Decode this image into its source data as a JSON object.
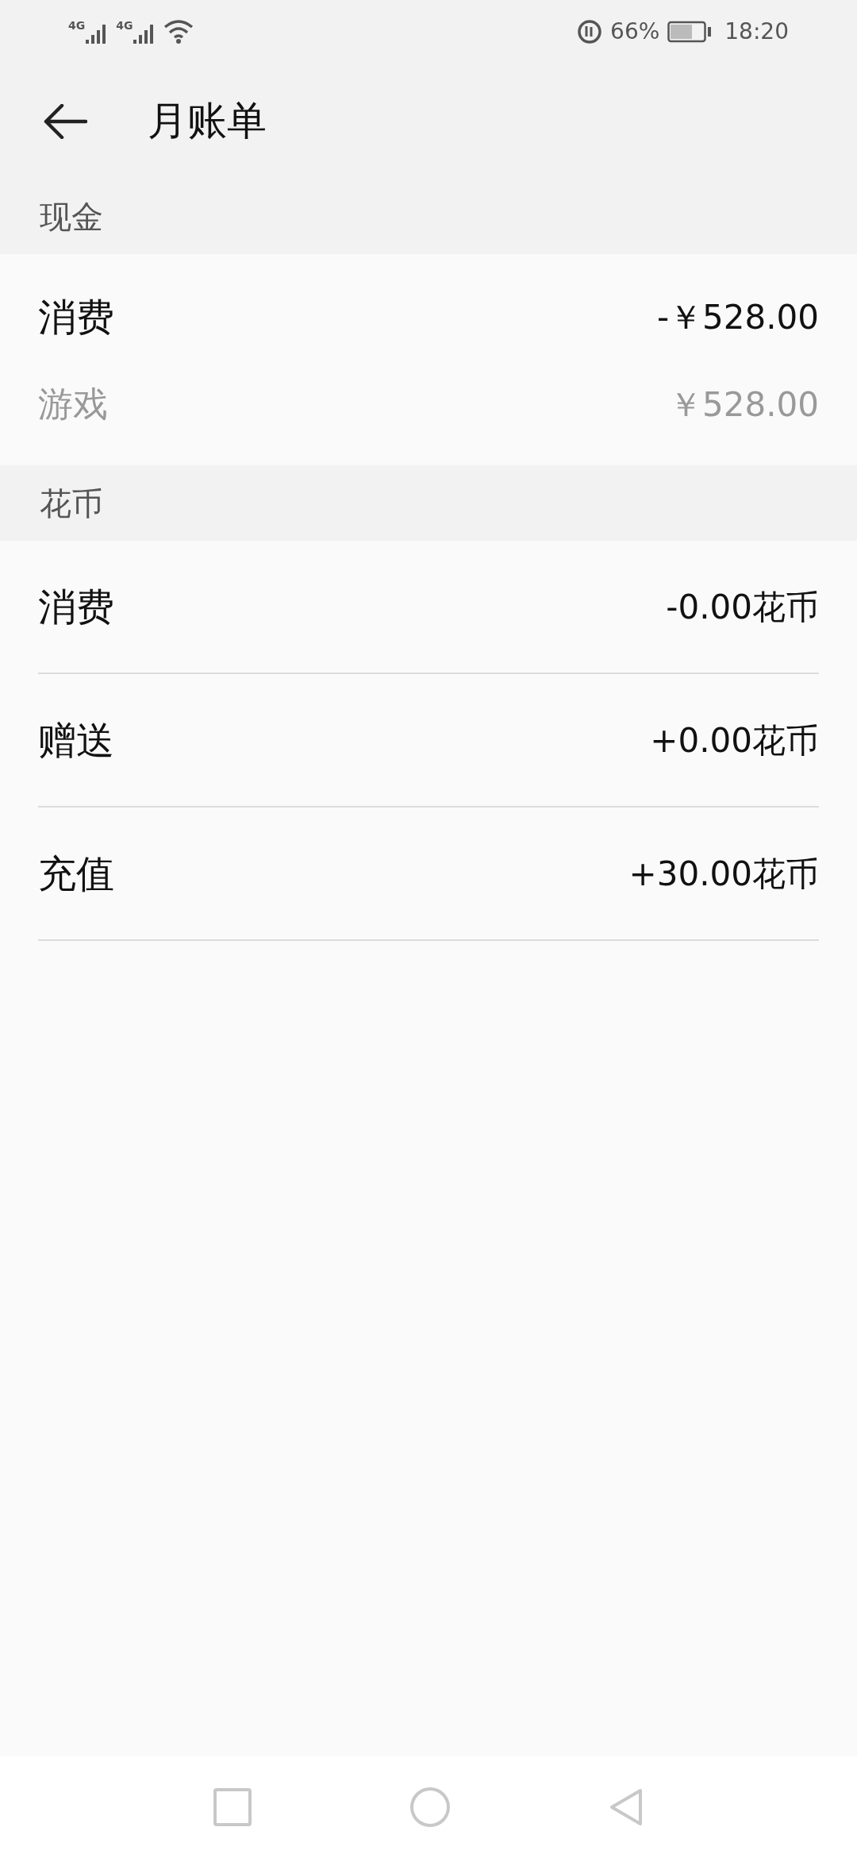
{
  "status_bar": {
    "signals": [
      "4G",
      "4G"
    ],
    "battery": "66%",
    "time": "18:20"
  },
  "header": {
    "title": "月账单"
  },
  "sections": [
    {
      "title": "现金",
      "kind": "plain",
      "rows": [
        {
          "label": "消费",
          "amount": "-￥528.00",
          "kind": "main"
        },
        {
          "label": "游戏",
          "amount": "￥528.00",
          "kind": "sub"
        }
      ]
    },
    {
      "title": "花币",
      "kind": "divided",
      "rows": [
        {
          "label": "消费",
          "amount": "-0.00花币",
          "kind": "main"
        },
        {
          "label": "赠送",
          "amount": "+0.00花币",
          "kind": "main"
        },
        {
          "label": "充值",
          "amount": "+30.00花币",
          "kind": "main"
        }
      ]
    }
  ]
}
